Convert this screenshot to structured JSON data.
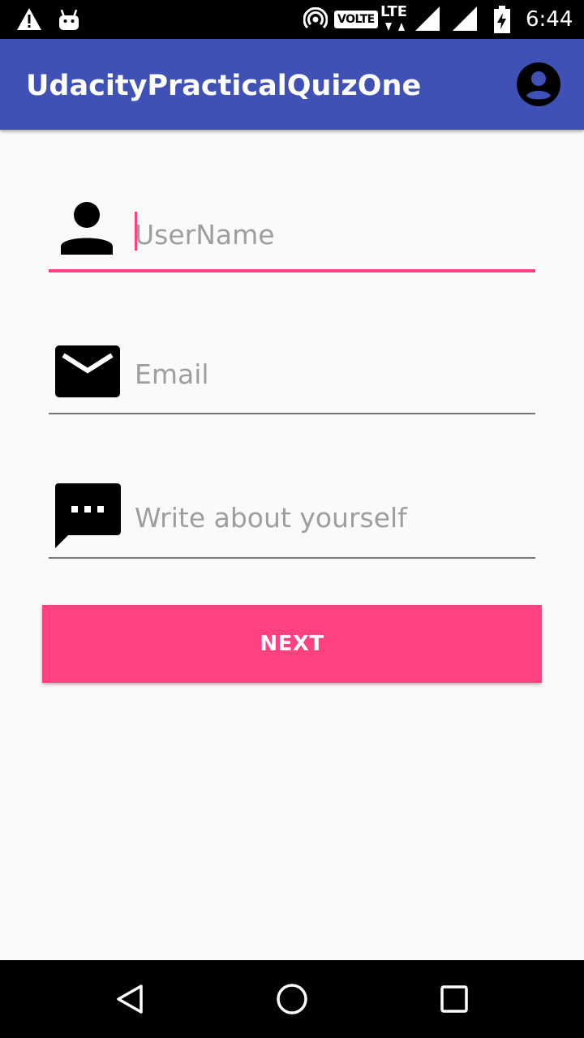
{
  "status_bar": {
    "time": "6:44",
    "volte": "VOLTE",
    "network": "LTE",
    "icons": [
      "warning-icon",
      "android-icon",
      "hotspot-icon",
      "signal-icon",
      "signal-icon",
      "battery-icon"
    ]
  },
  "app_bar": {
    "title": "UdacityPracticalQuizOne",
    "action_icon": "account-circle-icon",
    "color": "#3f51b5"
  },
  "form": {
    "username": {
      "placeholder": "UserName",
      "value": "",
      "icon": "person-icon",
      "focused": true
    },
    "email": {
      "placeholder": "Email",
      "value": "",
      "icon": "email-icon"
    },
    "about": {
      "placeholder": "Write about yourself",
      "value": "",
      "icon": "message-icon"
    },
    "accent_color": "#ff4081"
  },
  "next_button": {
    "label": "NEXT"
  },
  "nav_bar": {
    "icons": [
      "back-icon",
      "home-icon",
      "recents-icon"
    ]
  }
}
